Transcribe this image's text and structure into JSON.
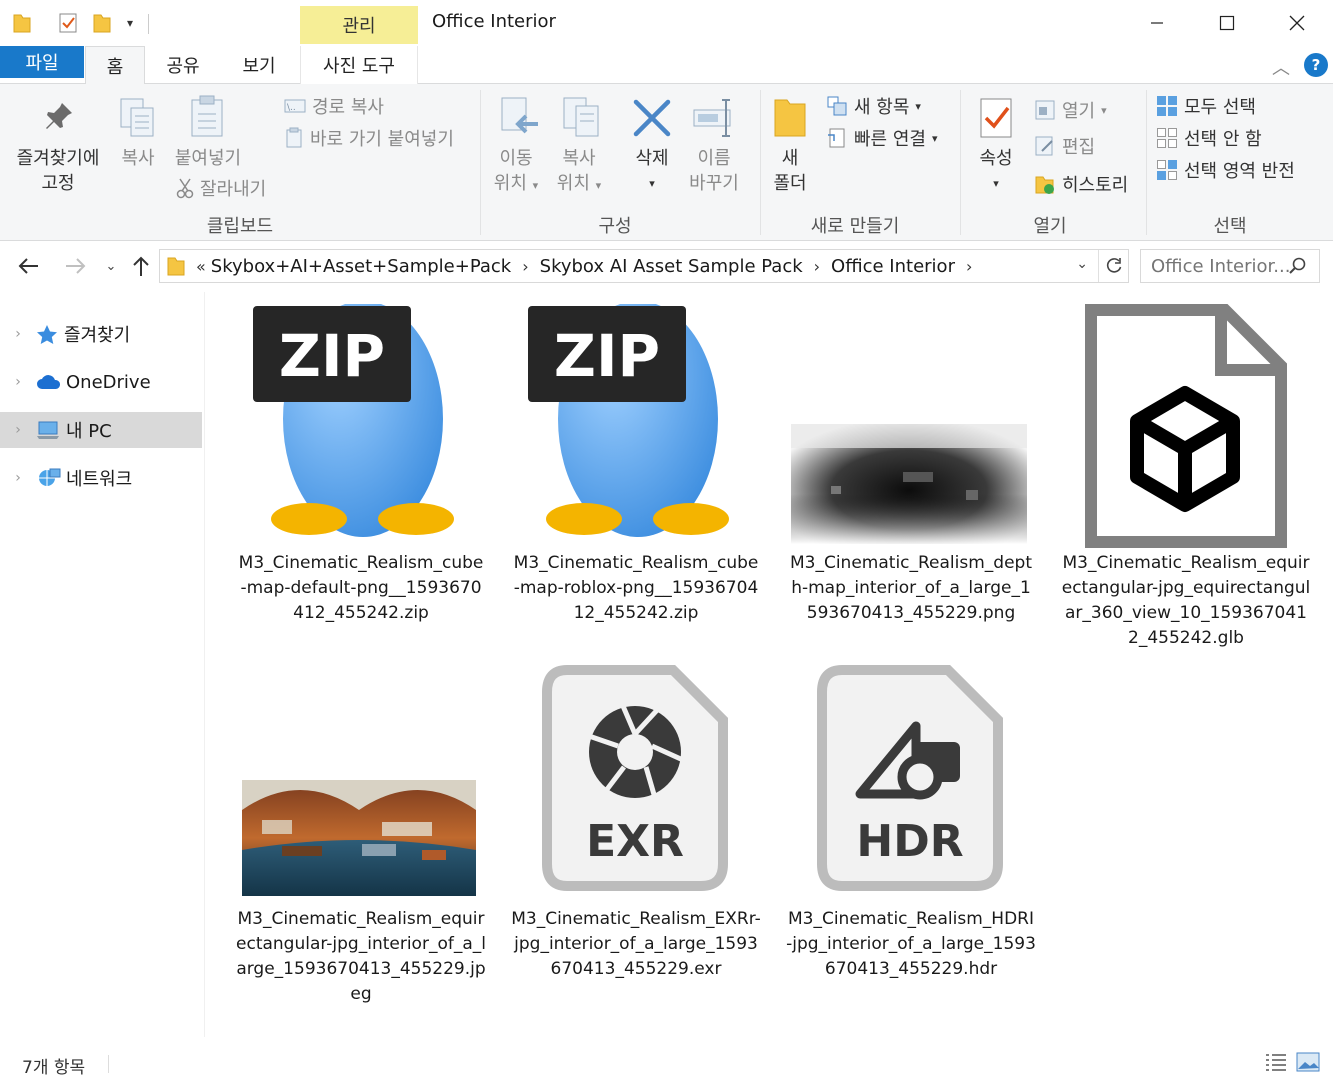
{
  "window": {
    "title": "Office Interior",
    "context_tab": "관리"
  },
  "tabs": {
    "file": "파일",
    "home": "홈",
    "share": "공유",
    "view": "보기",
    "photo_tools": "사진 도구"
  },
  "ribbon": {
    "clipboard": {
      "group": "클립보드",
      "pin_line1": "즐겨찾기에",
      "pin_line2": "고정",
      "copy": "복사",
      "paste": "붙여넣기",
      "copy_path": "경로 복사",
      "paste_shortcut": "바로 가기 붙여넣기",
      "cut": "잘라내기"
    },
    "organize": {
      "group": "구성",
      "move_line1": "이동",
      "move_line2": "위치",
      "copy_line1": "복사",
      "copy_line2": "위치",
      "delete": "삭제",
      "rename_line1": "이름",
      "rename_line2": "바꾸기"
    },
    "new": {
      "group": "새로 만들기",
      "folder_line1": "새",
      "folder_line2": "폴더",
      "new_item": "새 항목",
      "easy_access": "빠른 연결"
    },
    "open": {
      "group": "열기",
      "properties": "속성",
      "open": "열기",
      "edit": "편집",
      "history": "히스토리"
    },
    "select": {
      "group": "선택",
      "select_all": "모두 선택",
      "select_none": "선택 안 함",
      "invert": "선택 영역 반전"
    }
  },
  "address": {
    "overflow": "«",
    "crumbs": [
      "Skybox+AI+Asset+Sample+Pack",
      "Skybox AI Asset Sample Pack",
      "Office Interior"
    ],
    "search_placeholder": "Office Interior..."
  },
  "nav_pane": {
    "items": [
      {
        "label": "즐겨찾기"
      },
      {
        "label": "OneDrive"
      },
      {
        "label": "내 PC"
      },
      {
        "label": "네트워크"
      }
    ]
  },
  "files": [
    {
      "name": "M3_Cinematic_Realism_cube-map-default-png__1593670412_455242.zip",
      "icon": "zip-archive-icon",
      "badge": "ZIP"
    },
    {
      "name": "M3_Cinematic_Realism_cube-map-roblox-png__1593670412_455242.zip",
      "icon": "zip-archive-icon",
      "badge": "ZIP"
    },
    {
      "name": "M3_Cinematic_Realism_depth-map_interior_of_a_large_1593670413_455229.png",
      "icon": "depth-map-thumbnail"
    },
    {
      "name": "M3_Cinematic_Realism_equirectangular-jpg_equirectangular_360_view_10_1593670412_455242.glb",
      "icon": "3d-model-file-icon"
    },
    {
      "name": "M3_Cinematic_Realism_equirectangular-jpg_interior_of_a_large_1593670413_455229.jpeg",
      "icon": "panorama-thumbnail"
    },
    {
      "name": "M3_Cinematic_Realism_EXRr-jpg_interior_of_a_large_1593670413_455229.exr",
      "icon": "exr-file-icon",
      "badge": "EXR"
    },
    {
      "name": "M3_Cinematic_Realism_HDRI-jpg_interior_of_a_large_1593670413_455229.hdr",
      "icon": "hdr-file-icon",
      "badge": "HDR"
    }
  ],
  "status": {
    "count": "7개 항목"
  },
  "colors": {
    "file_tab": "#1979ca",
    "context_tab": "#f6ee96",
    "ribbon_bg": "#f5f6f7",
    "selection": "#d9d9d9"
  }
}
